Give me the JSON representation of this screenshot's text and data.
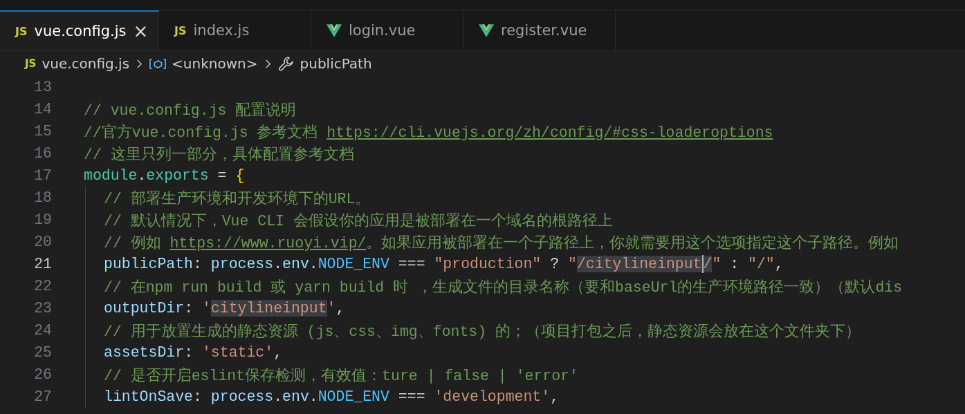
{
  "tabs": [
    {
      "kind": "js",
      "icon_text": "JS",
      "label": "vue.config.js",
      "selected": true,
      "close": "×"
    },
    {
      "kind": "js",
      "icon_text": "JS",
      "label": "index.js",
      "selected": false
    },
    {
      "kind": "vue",
      "label": "login.vue",
      "selected": false
    },
    {
      "kind": "vue",
      "label": "register.vue",
      "selected": false
    }
  ],
  "breadcrumb": [
    {
      "kind": "file",
      "icon_text": "JS",
      "label": "vue.config.js"
    },
    {
      "kind": "symbol",
      "label": "<unknown>"
    },
    {
      "kind": "property",
      "label": "publicPath"
    }
  ],
  "lines": [
    {
      "number": "13",
      "current": false,
      "indented": false
    },
    {
      "number": "14",
      "current": false,
      "indented": false,
      "tokens": [
        {
          "kind": "comment",
          "text": "// vue.config.js 配置说明"
        }
      ]
    },
    {
      "number": "15",
      "current": false,
      "indented": false,
      "tokens": [
        {
          "kind": "comment",
          "text": "//官方vue.config.js 参考文档 "
        },
        {
          "kind": "link",
          "text": "https://cli.vuejs.org/zh/config/#css-loaderoptions"
        }
      ]
    },
    {
      "number": "16",
      "current": false,
      "indented": false,
      "tokens": [
        {
          "kind": "comment",
          "text": "// 这里只列一部分，具体配置参考文档"
        }
      ]
    },
    {
      "number": "17",
      "current": false,
      "indented": false,
      "tokens": [
        {
          "kind": "var",
          "text": "module"
        },
        {
          "kind": "op",
          "text": "."
        },
        {
          "kind": "var",
          "text": "exports"
        },
        {
          "kind": "op",
          "text": " = "
        },
        {
          "kind": "brace",
          "text": "{"
        }
      ]
    },
    {
      "number": "18",
      "current": false,
      "indented": true,
      "tokens": [
        {
          "kind": "comment",
          "text": "// 部署生产环境和开发环境下的URL。"
        }
      ]
    },
    {
      "number": "19",
      "current": false,
      "indented": true,
      "tokens": [
        {
          "kind": "comment",
          "text": "// 默认情况下，Vue CLI 会假设你的应用是被部署在一个域名的根路径上"
        }
      ]
    },
    {
      "number": "20",
      "current": false,
      "indented": true,
      "tokens": [
        {
          "kind": "comment",
          "text": "// 例如 "
        },
        {
          "kind": "link",
          "text": "https://www.ruoyi.vip/"
        },
        {
          "kind": "comment",
          "text": "。如果应用被部署在一个子路径上，你就需要用这个选项指定这个子路径。例如"
        }
      ]
    },
    {
      "number": "21",
      "current": true,
      "indented": true,
      "tokens": [
        {
          "kind": "key",
          "text": "publicPath"
        },
        {
          "kind": "op",
          "text": ": "
        },
        {
          "kind": "key",
          "text": "process"
        },
        {
          "kind": "op",
          "text": "."
        },
        {
          "kind": "key",
          "text": "env"
        },
        {
          "kind": "op",
          "text": "."
        },
        {
          "kind": "const",
          "text": "NODE_ENV"
        },
        {
          "kind": "op",
          "text": " === "
        },
        {
          "kind": "str",
          "text": "\"production\""
        },
        {
          "kind": "op",
          "text": " ? "
        },
        {
          "kind": "str",
          "text": "\""
        },
        {
          "kind": "sel",
          "text": "/citylineinput"
        },
        {
          "kind": "cursor"
        },
        {
          "kind": "sel",
          "text": "/"
        },
        {
          "kind": "str",
          "text": "\""
        },
        {
          "kind": "op",
          "text": " : "
        },
        {
          "kind": "str",
          "text": "\"/\""
        },
        {
          "kind": "op",
          "text": ","
        }
      ]
    },
    {
      "number": "22",
      "current": false,
      "indented": true,
      "tokens": [
        {
          "kind": "comment",
          "text": "// 在npm run build 或 yarn build 时 ，生成文件的目录名称（要和baseUrl的生产环境路径一致）（默认dis"
        }
      ]
    },
    {
      "number": "23",
      "current": false,
      "indented": true,
      "tokens": [
        {
          "kind": "key",
          "text": "outputDir"
        },
        {
          "kind": "op",
          "text": ": "
        },
        {
          "kind": "str",
          "text": "'"
        },
        {
          "kind": "sel",
          "text": "citylineinput"
        },
        {
          "kind": "str",
          "text": "'"
        },
        {
          "kind": "op",
          "text": ","
        }
      ]
    },
    {
      "number": "24",
      "current": false,
      "indented": true,
      "tokens": [
        {
          "kind": "comment",
          "text": "// 用于放置生成的静态资源 (js、css、img、fonts) 的；（项目打包之后，静态资源会放在这个文件夹下）"
        }
      ]
    },
    {
      "number": "25",
      "current": false,
      "indented": true,
      "tokens": [
        {
          "kind": "key",
          "text": "assetsDir"
        },
        {
          "kind": "op",
          "text": ": "
        },
        {
          "kind": "str",
          "text": "'static'"
        },
        {
          "kind": "op",
          "text": ","
        }
      ]
    },
    {
      "number": "26",
      "current": false,
      "indented": true,
      "tokens": [
        {
          "kind": "comment",
          "text": "// 是否开启eslint保存检测，有效值：ture | false | 'error'"
        }
      ]
    },
    {
      "number": "27",
      "current": false,
      "indented": true,
      "tokens": [
        {
          "kind": "key",
          "text": "lintOnSave"
        },
        {
          "kind": "op",
          "text": ": "
        },
        {
          "kind": "key",
          "text": "process"
        },
        {
          "kind": "op",
          "text": "."
        },
        {
          "kind": "key",
          "text": "env"
        },
        {
          "kind": "op",
          "text": "."
        },
        {
          "kind": "const",
          "text": "NODE_ENV"
        },
        {
          "kind": "op",
          "text": " === "
        },
        {
          "kind": "str",
          "text": "'development'"
        },
        {
          "kind": "op",
          "text": ","
        }
      ]
    }
  ]
}
